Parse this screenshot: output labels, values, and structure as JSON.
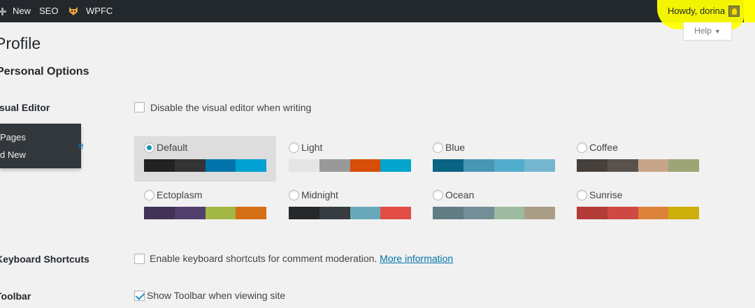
{
  "adminbar": {
    "new_label": "New",
    "seo_label": "SEO",
    "wpfc_label": "WPFC",
    "howdy": "Howdy, dorina"
  },
  "help": {
    "label": "Help",
    "arrow": "▼"
  },
  "page": {
    "title": "Profile",
    "section_title": "Personal Options"
  },
  "flyout": {
    "item1": "Pages",
    "item2": "d New",
    "edge": "e"
  },
  "visual_editor": {
    "label": "Visual Editor",
    "text": "Disable the visual editor when writing",
    "checked": false
  },
  "color_schemes": [
    {
      "name": "Default",
      "selected": true,
      "colors": [
        "#222222",
        "#333333",
        "#0073aa",
        "#00a0d2"
      ]
    },
    {
      "name": "Light",
      "selected": false,
      "colors": [
        "#e5e5e5",
        "#999999",
        "#d64e07",
        "#04a4cc"
      ]
    },
    {
      "name": "Blue",
      "selected": false,
      "colors": [
        "#096484",
        "#4796b3",
        "#52accc",
        "#74b6ce"
      ]
    },
    {
      "name": "Coffee",
      "selected": false,
      "colors": [
        "#46403c",
        "#59524c",
        "#c7a589",
        "#9ea476"
      ]
    },
    {
      "name": "Ectoplasm",
      "selected": false,
      "colors": [
        "#413256",
        "#523f6d",
        "#a3b745",
        "#d46f15"
      ]
    },
    {
      "name": "Midnight",
      "selected": false,
      "colors": [
        "#25282b",
        "#363b3f",
        "#69a8bb",
        "#e14d43"
      ]
    },
    {
      "name": "Ocean",
      "selected": false,
      "colors": [
        "#627c83",
        "#738e96",
        "#9ebaa0",
        "#aa9d88"
      ]
    },
    {
      "name": "Sunrise",
      "selected": false,
      "colors": [
        "#b43c38",
        "#cf4944",
        "#dd823b",
        "#ccaf0b"
      ]
    }
  ],
  "keyboard_shortcuts": {
    "label": "Keyboard Shortcuts",
    "text": "Enable keyboard shortcuts for comment moderation.",
    "link": "More information",
    "checked": false
  },
  "toolbar": {
    "label": "Toolbar",
    "text": "Show Toolbar when viewing site",
    "checked": true
  }
}
